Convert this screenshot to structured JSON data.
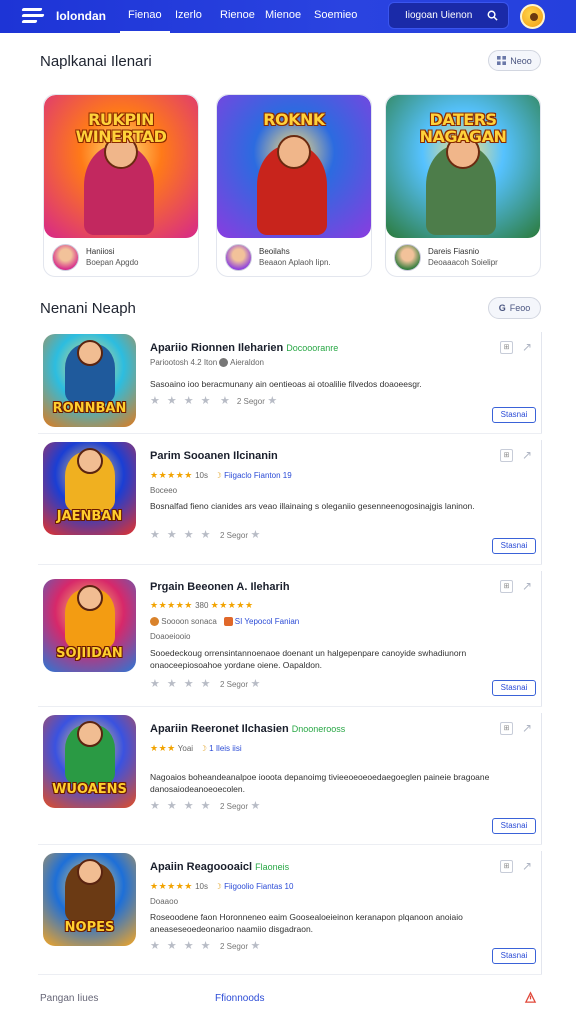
{
  "header": {
    "brand": "Iolondan",
    "nav": [
      "Fienao",
      "Izerlo",
      "Rienoe",
      "Mienoe",
      "Soemieo"
    ],
    "active_index": 0,
    "search_text": "Iiogoan Uienon",
    "colors": {
      "bar": "#1f36d8",
      "accent": "#2b4bd6"
    }
  },
  "featured": {
    "title": "Naplkanai Ilenari",
    "more_label": "Neoo",
    "cards": [
      {
        "banner": "RUKPIN WINERTAD",
        "name": "Haniiosi",
        "sub": "Boepan Apgdo",
        "colors": [
          "#ff7a18",
          "#d6288a",
          "#c2285f"
        ]
      },
      {
        "banner": "ROKNK",
        "name": "Beoilahs",
        "sub": "Beaaon Aplaoh Iipn.",
        "colors": [
          "#2c6be0",
          "#8a3ce0",
          "#c8241c"
        ]
      },
      {
        "banner": "DATERS NAGAGAN",
        "name": "Dareis Fiasnio",
        "sub": "Deoaaacoh Soielipr",
        "colors": [
          "#56c2ff",
          "#2b7a3a",
          "#4d7d4a"
        ]
      }
    ]
  },
  "list": {
    "title": "Nenani Neaph",
    "more_label": "Feoo",
    "install_label": "Stasnai",
    "games": [
      {
        "banner": "RONNBAN",
        "title": "Apariio Rionnen Ileharien",
        "tag": "Docoooranre",
        "meta": "Pariootosh 4.2 Iton",
        "meta2": "Aieraldon",
        "desc": "Sasoaino ioo beracmunany ain oentieoas ai otoalilie filvedos doaoeesgr.",
        "rating_count": "2 Segor",
        "colors": [
          "#2cbde0",
          "#e07a1c",
          "#1f5a9c"
        ]
      },
      {
        "banner": "JAENBAN",
        "title": "Parim Sooanen Ilcinanin",
        "tag": "",
        "stars": "★★★★★",
        "meta": "10s",
        "meta2": "Fiigaclo Fianton 19",
        "sub": "Boceeo",
        "desc": "Bosnalfad fieno cianides ars veao illainaing s oleganiio gesenneenogosinajgis laninon.",
        "rating_count": "2 Segor",
        "colors": [
          "#1a3ed4",
          "#e6322a",
          "#f0b020"
        ]
      },
      {
        "banner": "SOJIIDAN",
        "title": "Prgain Beeonen A. Ileharih",
        "tag": "",
        "stars": "★★★★★",
        "meta": "380",
        "stars2": "★★★★★",
        "meta3": "Soooon sonaca",
        "meta4": "SI Yepocol Fanian",
        "sub": "Doaoeiooio",
        "desc": "Sooedeckoug orrensintannoenaoe doenant un halgepenpare canoyide swhadiunorn onaoceepiosoahoe yordane oiene. Oapaldon.",
        "rating_count": "2 Segor",
        "colors": [
          "#d7286a",
          "#2a78d6",
          "#f39c12"
        ]
      },
      {
        "banner": "WUOAENS",
        "title": "Apariin Reeronet Ilchasien",
        "tag": "Dnoonerooss",
        "stars": "★★★",
        "meta": "Yoai",
        "meta2": "1 Ileis iisi",
        "desc": "Nagoaios boheandeanalpoe iooota depanoimg tivieeoeoeoedaegoeglen paineie bragoane danosaiodeanoeoecolen.",
        "rating_count": "2 Segor",
        "colors": [
          "#3a52e0",
          "#e34d24",
          "#2a9a44"
        ]
      },
      {
        "banner": "NOPES",
        "title": "Apaiin Reagoooaicl",
        "tag": "Flaoneis",
        "stars": "★★★★★",
        "meta": "10s",
        "meta2": "Fiigoolio Fiantas 10",
        "sub": "Doaaoo",
        "desc": "Roseoodene faon Horonneneo eaim Goosealoeieinon keranapon plqanoon anoiaio aneaseseoedeonarioo naamiio disgadraon.",
        "rating_count": "2 Segor",
        "colors": [
          "#1d6fd8",
          "#f5a623",
          "#6b3a14"
        ]
      }
    ]
  },
  "footer": {
    "left": "Pangan Iiues",
    "mid": "Ffionnoods"
  }
}
